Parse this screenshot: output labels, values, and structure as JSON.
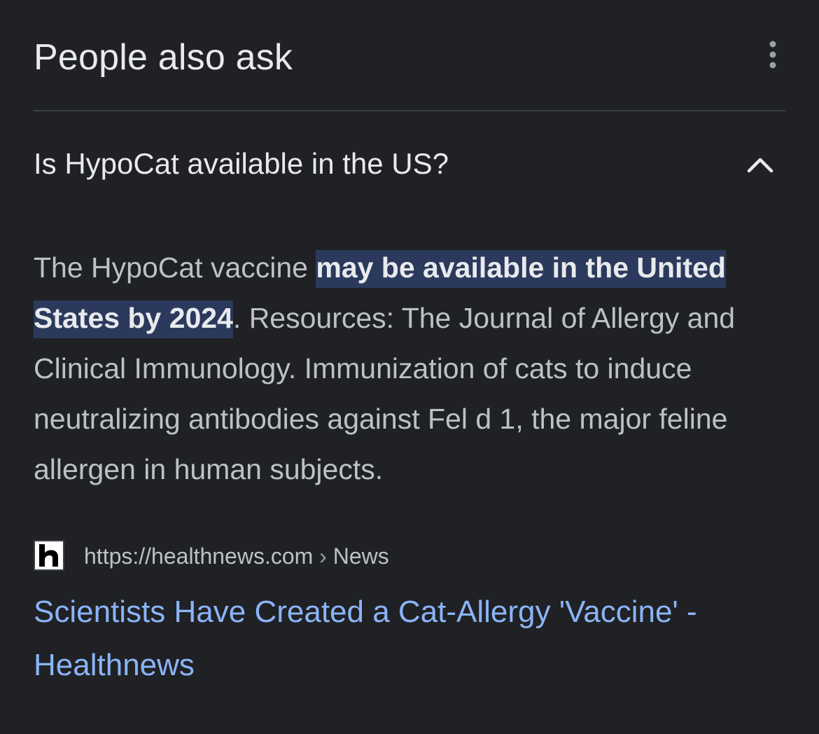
{
  "header": {
    "title": "People also ask",
    "more_icon": "more-vert-icon"
  },
  "question": {
    "text": "Is HypoCat available in the US?",
    "chevron_icon": "chevron-up-icon"
  },
  "answer": {
    "prefix": "The HypoCat vaccine ",
    "highlight": "may be available in the United States by 2024",
    "suffix": ". Resources: The Journal of Allergy and Clinical Immunology. Immunization of cats to induce neutralizing antibodies against Fel d 1, the major feline allergen in human subjects."
  },
  "source": {
    "favicon_icon": "healthnews-logo-icon",
    "url": "https://healthnews.com",
    "separator": " › ",
    "breadcrumb": "News"
  },
  "result": {
    "title": "Scientists Have Created a Cat-Allergy 'Vaccine' - Healthnews"
  },
  "colors": {
    "background": "#202124",
    "text_primary": "#e8eaed",
    "text_secondary": "#bdc1c6",
    "highlight_bg": "#2b3a5c",
    "link": "#8ab4f8",
    "divider": "#3c4043"
  }
}
